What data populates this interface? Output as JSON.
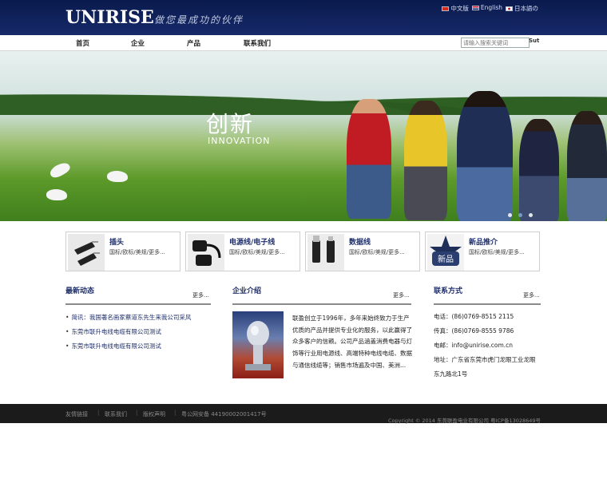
{
  "header": {
    "logo": "UNIRISE",
    "slogan": "做您最成功的伙伴",
    "languages": [
      "中文版",
      "English",
      "日本語の"
    ]
  },
  "nav": {
    "items": [
      "首页",
      "企业",
      "产品",
      "联系我们"
    ],
    "search_placeholder": "请输入搜索关键词",
    "search_button": "Sut"
  },
  "banner": {
    "title_cn": "创新",
    "title_en": "INNOVATION",
    "slide_count": 3,
    "active_slide": 2
  },
  "categories": [
    {
      "title": "插头",
      "desc": "国标/欧标/美规/更多..."
    },
    {
      "title": "电源线/电子线",
      "desc": "国标/欧标/美规/更多..."
    },
    {
      "title": "数据线",
      "desc": "国标/欧标/美规/更多..."
    },
    {
      "title": "新品推介",
      "desc": "国标/欧标/美规/更多..."
    }
  ],
  "news": {
    "title": "最新动态",
    "more": "更多...",
    "items": [
      "简讯：我国著名画家蔡道东先生来我公司采风",
      "东莞市联升电线电缆有限公司测试",
      "东莞市联升电线电缆有限公司测试"
    ]
  },
  "about": {
    "title": "企业介绍",
    "more": "更多...",
    "text": "联盈创立于1996年，多年来始终致力于生产优质的产品并提供专业化的服务，以此赢得了众多客户的信赖。公司产品涵盖消费电器与灯饰等行业用电源线、高端特种电线电缆、数据与通信线缆等；销售市场遍及中国、美洲..."
  },
  "contact": {
    "title": "联系方式",
    "more": "更多...",
    "phone": "电话：(86)0769-8515 2115",
    "fax": "传真：(86)0769-8555 9786",
    "email": "电邮：info@unirise.com.cn",
    "address_line1": "地址：广东省东莞市虎门龙眼工业龙眼",
    "address_line2": "东九路北1号"
  },
  "footer": {
    "links": [
      "友情链接",
      "联系我们",
      "版权声明",
      "粤公网安备 44190002001417号"
    ],
    "copyright": "Copyright © 2014 东莞联盈电业有限公司 粤ICP备13028649号"
  },
  "colors": {
    "header_bg": "#0a1a4d",
    "title_blue": "#1f2f6b",
    "footer_bg": "#1b1b1b"
  }
}
